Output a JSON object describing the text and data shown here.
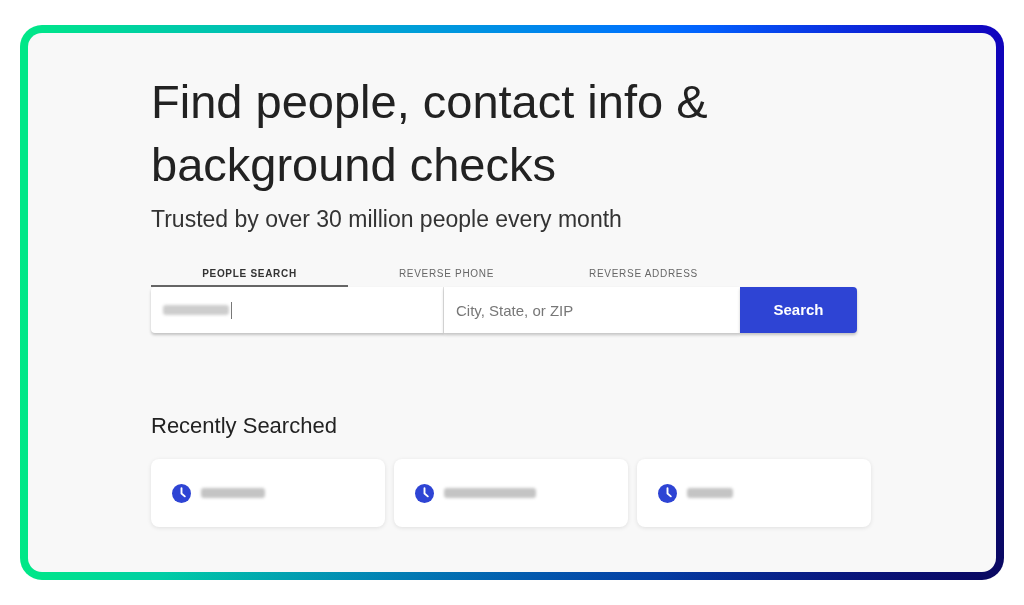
{
  "heading": "Find people, contact info & background checks",
  "subtitle": "Trusted by over 30 million people every month",
  "tabs": [
    {
      "label": "PEOPLE SEARCH",
      "selected": true
    },
    {
      "label": "REVERSE PHONE",
      "selected": false
    },
    {
      "label": "REVERSE ADDRESS",
      "selected": false
    }
  ],
  "search": {
    "name_field": {
      "kind": "redacted"
    },
    "location_field": {
      "placeholder": "City, State, or ZIP"
    },
    "button": "Search"
  },
  "recent": {
    "title": "Recently Searched",
    "items": [
      {
        "kind": "redacted"
      },
      {
        "kind": "redacted"
      },
      {
        "kind": "redacted"
      }
    ]
  }
}
